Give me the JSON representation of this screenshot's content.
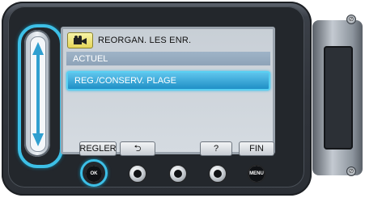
{
  "menu": {
    "title": "REORGAN. LES ENR.",
    "mode_icon": "video-camera-icon",
    "items": [
      {
        "label": "ACTUEL",
        "selected": false
      },
      {
        "label": "REG./CONSERV. PLAGE",
        "selected": true
      }
    ]
  },
  "softkeys": {
    "regler": "REGLER",
    "back": "⮌",
    "help": "?",
    "fin": "FIN"
  },
  "hardware_buttons": {
    "ok_label": "OK",
    "menu_label": "MENU"
  },
  "colors": {
    "highlight": "#3dbfe6",
    "selected_row": "#1f8fc6",
    "screen_bg": "#d5dbe1"
  }
}
